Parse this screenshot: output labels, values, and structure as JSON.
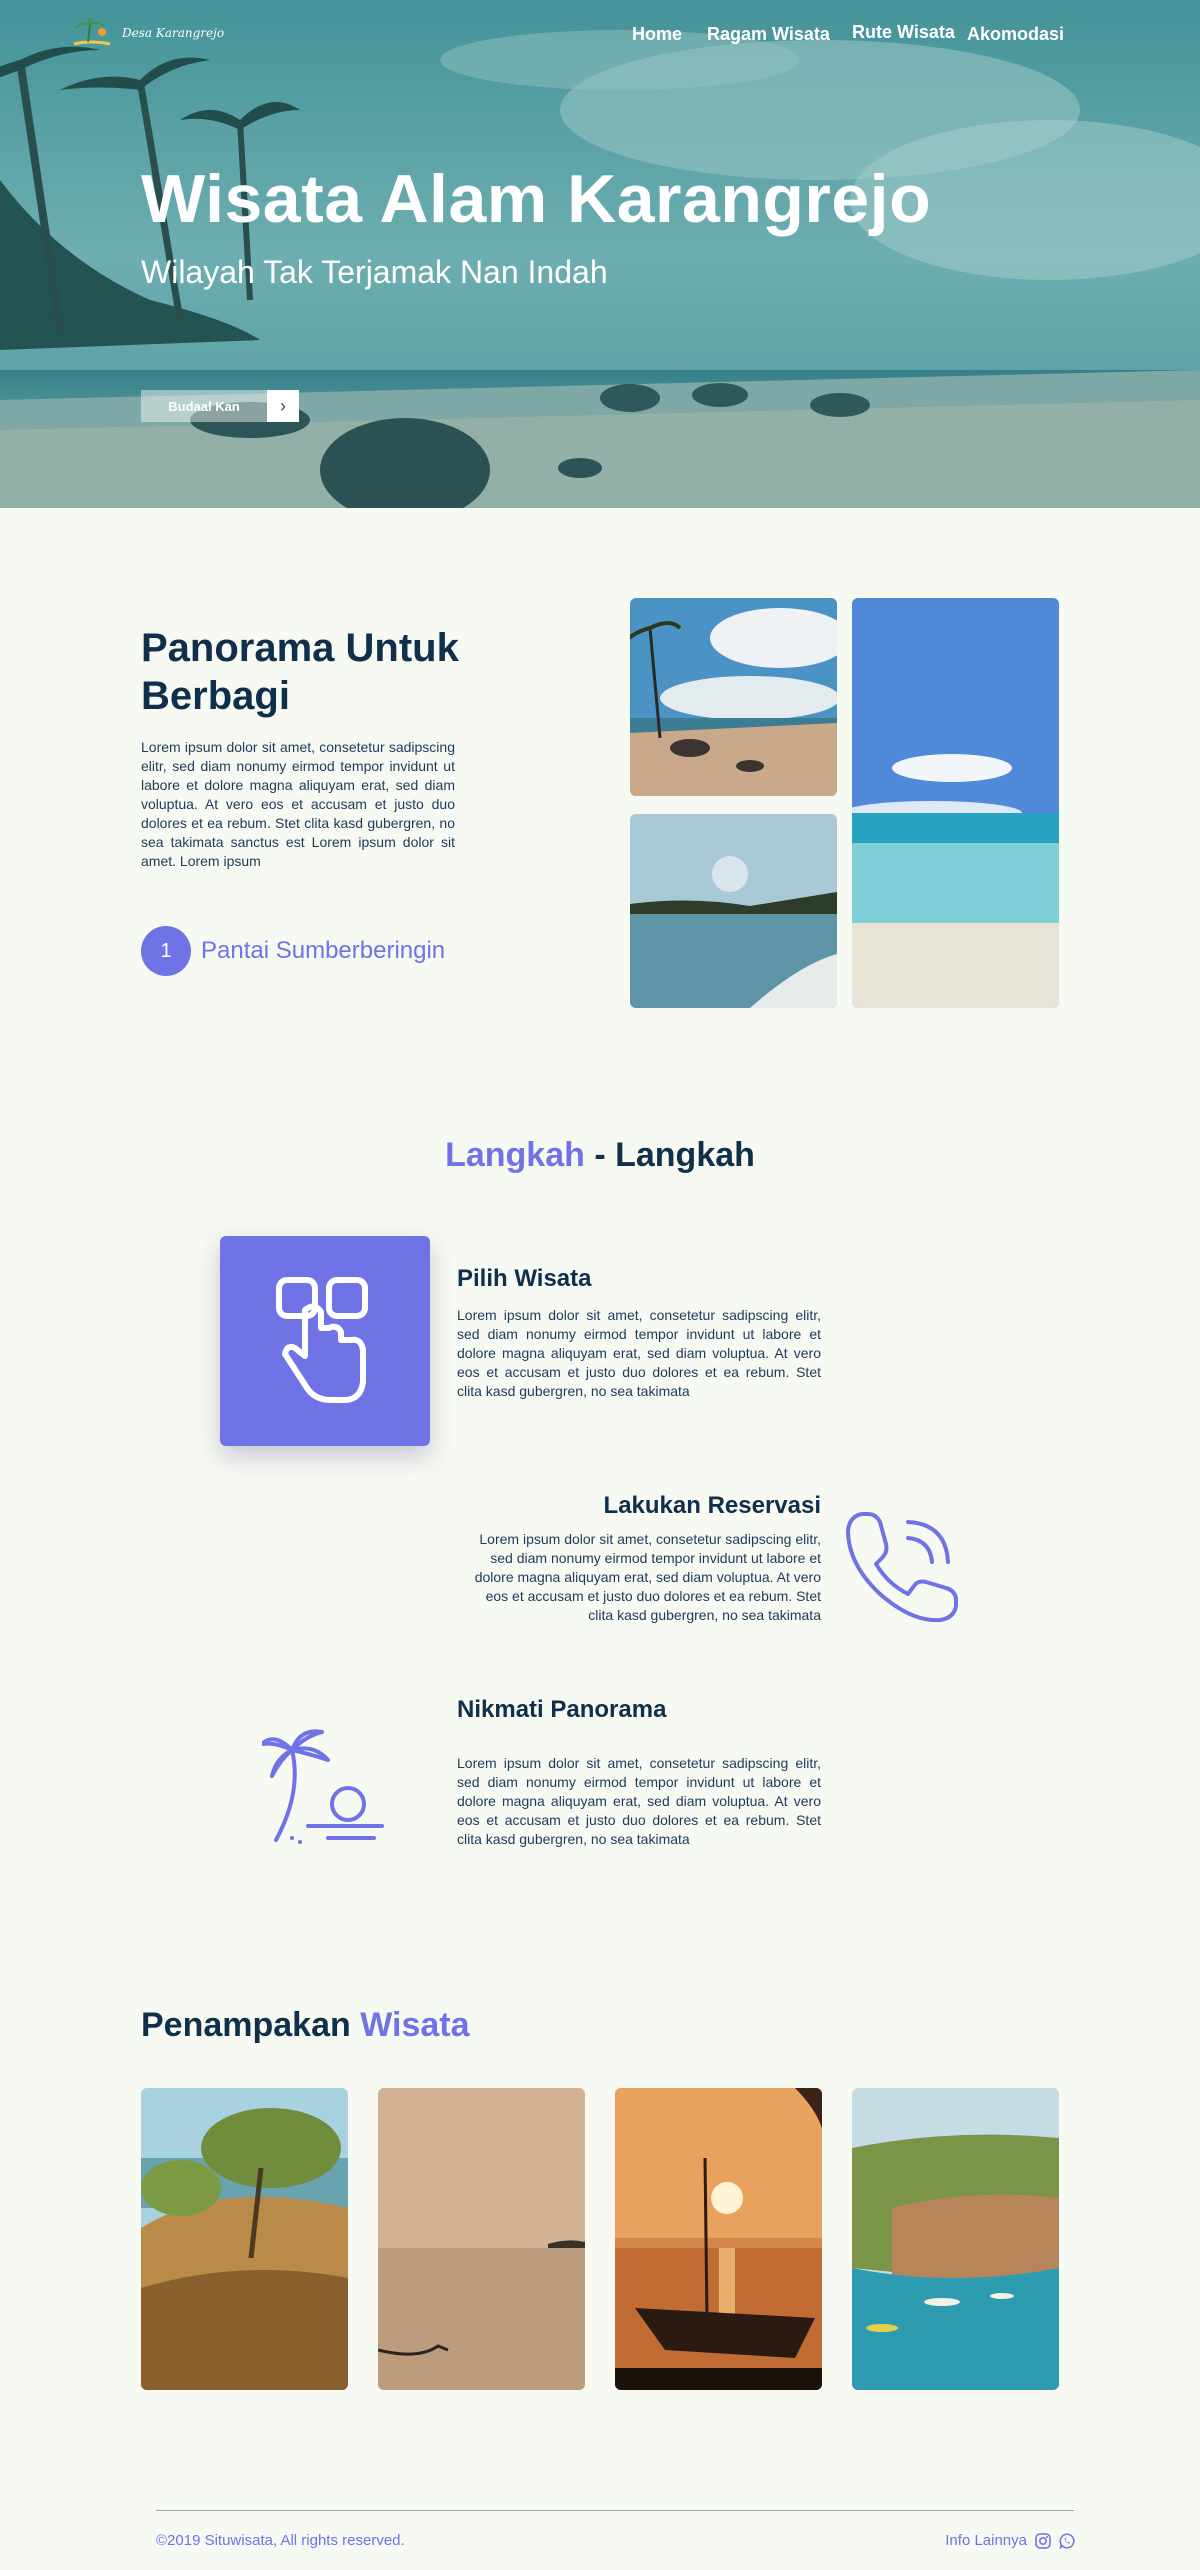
{
  "header": {
    "logo_text": "Desa Karangrejo",
    "nav": [
      "Home",
      "Ragam Wisata",
      "Rute Wisata",
      "Akomodasi"
    ]
  },
  "hero": {
    "title": "Wisata Alam Karangrejo",
    "subtitle": "Wilayah Tak Terjamak Nan Indah",
    "button_label": "Budaal Kan"
  },
  "panorama": {
    "title": "Panorama Untuk Berbagi",
    "text": "Lorem ipsum dolor sit amet, consetetur sadipscing elitr, sed diam nonumy eirmod tempor invidunt ut labore et dolore magna aliquyam erat, sed diam voluptua. At vero eos et accusam et justo duo dolores et ea rebum. Stet clita kasd gubergren, no sea takimata sanctus est Lorem ipsum dolor sit amet. Lorem ipsum",
    "item_number": "1",
    "item_name": "Pantai Sumberberingin"
  },
  "steps": {
    "title_accent": "Langkah",
    "title_sep": " - ",
    "title_rest": "Langkah",
    "items": [
      {
        "title": "Pilih Wisata",
        "text": "Lorem ipsum dolor sit amet, consetetur sadipscing elitr, sed diam nonumy eirmod tempor invidunt ut labore et dolore magna aliquyam erat, sed diam voluptua. At vero eos et accusam et justo duo dolores et ea rebum. Stet clita kasd gubergren, no sea takimata",
        "icon": "hand-tap-icon"
      },
      {
        "title": "Lakukan Reservasi",
        "text": "Lorem ipsum dolor sit amet, consetetur sadipscing elitr, sed diam nonumy eirmod tempor invidunt ut labore et dolore magna aliquyam erat, sed diam voluptua. At vero eos et accusam et justo duo dolores et ea rebum. Stet clita kasd gubergren, no sea takimata",
        "icon": "phone-icon"
      },
      {
        "title": "Nikmati Panorama",
        "text": "Lorem ipsum dolor sit amet, consetetur sadipscing elitr, sed diam nonumy eirmod tempor invidunt ut labore et dolore magna aliquyam erat, sed diam voluptua. At vero eos et accusam et justo duo dolores et ea rebum. Stet clita kasd gubergren, no sea takimata",
        "icon": "palm-sunset-icon"
      }
    ]
  },
  "gallery": {
    "title_main": "Penampakan",
    "title_accent": "Wisata"
  },
  "footer": {
    "copyright": "©2019 Situwisata, All rights reserved.",
    "info": "Info Lainnya"
  },
  "colors": {
    "accent": "#6f73e6",
    "navy": "#0f2f4a",
    "background": "#f7f9f3"
  }
}
